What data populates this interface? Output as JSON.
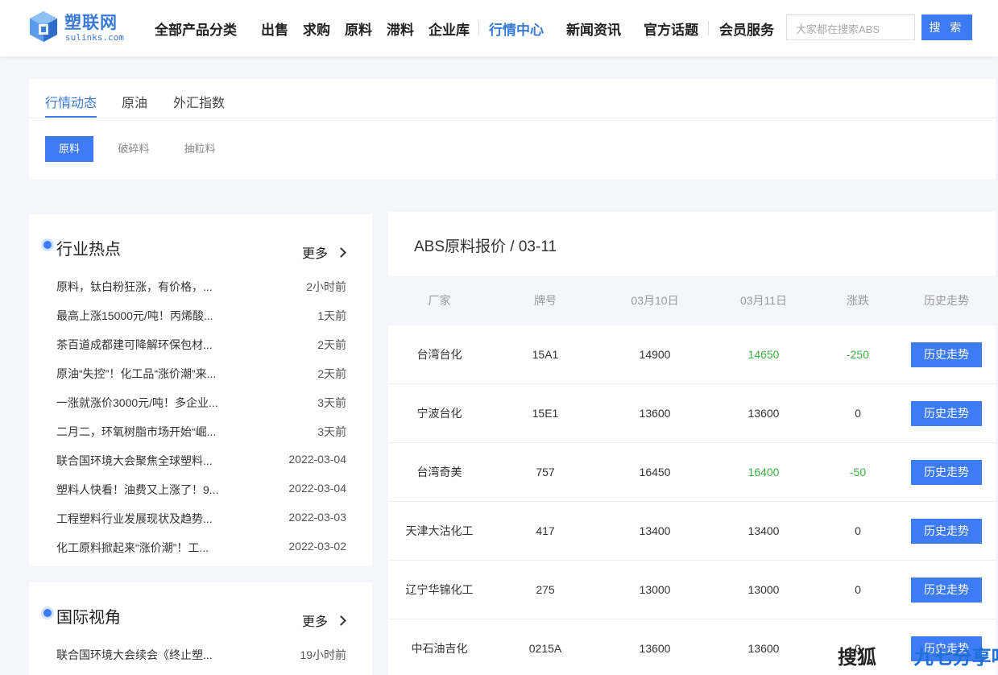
{
  "colors": {
    "primary": "#3e7bf7",
    "brand": "#3a7bd5",
    "up_down_green": "#3cb043"
  },
  "logo": {
    "name_cn": "塑联网",
    "name_en": "sulinks.com",
    "icon": "cube-logo-icon"
  },
  "nav": {
    "items": [
      "全部产品分类",
      "出售",
      "求购",
      "原料",
      "滞料",
      "企业库",
      "行情中心",
      "新闻资讯",
      "官方话题",
      "会员服务"
    ],
    "active": "行情中心"
  },
  "search": {
    "placeholder": "大家都在搜索ABS",
    "button_label": "搜 索"
  },
  "tabs": {
    "items": [
      "行情动态",
      "原油",
      "外汇指数"
    ],
    "active": "行情动态"
  },
  "subtabs": {
    "items": [
      "原料",
      "破碎料",
      "抽粒料"
    ],
    "active": "原料"
  },
  "hot": {
    "title": "行业热点",
    "more_label": "更多",
    "items": [
      {
        "title": "原料，钛白粉狂涨，有价格，...",
        "time": "2小时前"
      },
      {
        "title": "最高上涨15000元/吨！丙烯酸...",
        "time": "1天前"
      },
      {
        "title": "茶百道成都建可降解环保包材...",
        "time": "2天前"
      },
      {
        "title": "原油“失控”！化工品“涨价潮”来...",
        "time": "2天前"
      },
      {
        "title": "一涨就涨价3000元/吨！多企业...",
        "time": "3天前"
      },
      {
        "title": "二月二，环氧树脂市场开始“崛...",
        "time": "3天前"
      },
      {
        "title": "联合国环境大会聚焦全球塑料...",
        "time": "2022-03-04"
      },
      {
        "title": "塑料人快看！油费又上涨了！9...",
        "time": "2022-03-04"
      },
      {
        "title": "工程塑料行业发展现状及趋势...",
        "time": "2022-03-03"
      },
      {
        "title": "化工原料掀起来“涨价潮”！工...",
        "time": "2022-03-02"
      }
    ]
  },
  "intl": {
    "title": "国际视角",
    "more_label": "更多",
    "items": [
      {
        "title": "联合国环境大会续会《终止塑...",
        "time": "19小时前"
      }
    ]
  },
  "price": {
    "title": "ABS原料报价 / 03-11",
    "headers": [
      "厂家",
      "牌号",
      "03月10日",
      "03月11日",
      "涨跌",
      "历史走势"
    ],
    "button_label": "历史走势",
    "rows": [
      {
        "maker": "台湾台化",
        "grade": "15A1",
        "prev": "14900",
        "curr": "14650",
        "change": "-250",
        "down": true
      },
      {
        "maker": "宁波台化",
        "grade": "15E1",
        "prev": "13600",
        "curr": "13600",
        "change": "0",
        "down": false
      },
      {
        "maker": "台湾奇美",
        "grade": "757",
        "prev": "16450",
        "curr": "16400",
        "change": "-50",
        "down": true
      },
      {
        "maker": "天津大沽化工",
        "grade": "417",
        "prev": "13400",
        "curr": "13400",
        "change": "0",
        "down": false
      },
      {
        "maker": "辽宁华锦化工",
        "grade": "275",
        "prev": "13000",
        "curr": "13000",
        "change": "0",
        "down": false
      },
      {
        "maker": "中石油吉化",
        "grade": "0215A",
        "prev": "13600",
        "curr": "13600",
        "change": "0",
        "down": false
      }
    ]
  },
  "watermark": {
    "part1": "搜狐",
    "part2": "九七分享吧"
  }
}
